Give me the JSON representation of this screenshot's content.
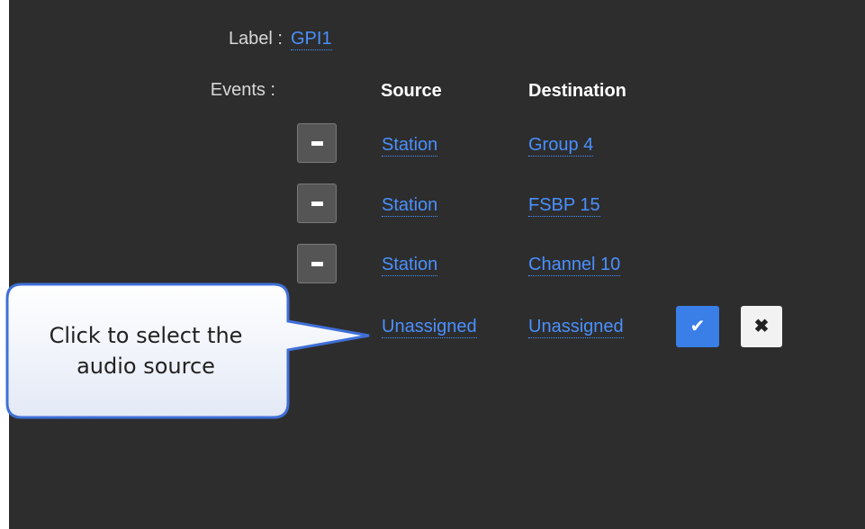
{
  "form": {
    "label_caption": "Label :",
    "label_value": "GPI1",
    "events_caption": "Events :",
    "source_header": "Source",
    "destination_header": "Destination"
  },
  "events": [
    {
      "source": "Station",
      "destination": "Group 4"
    },
    {
      "source": "Station",
      "destination": "FSBP 15"
    },
    {
      "source": "Station",
      "destination": "Channel 10"
    }
  ],
  "new_event": {
    "source": "Unassigned",
    "destination": "Unassigned",
    "confirm_icon": "✔",
    "cancel_icon": "✖"
  },
  "callout": {
    "line1": "Click to select the",
    "line2": "audio source"
  },
  "colors": {
    "background": "#2d2d2d",
    "link": "#4a90ff",
    "confirm_button": "#3a7ee8",
    "callout_fill": "#eef2fb",
    "callout_border": "#3f6fd8"
  }
}
